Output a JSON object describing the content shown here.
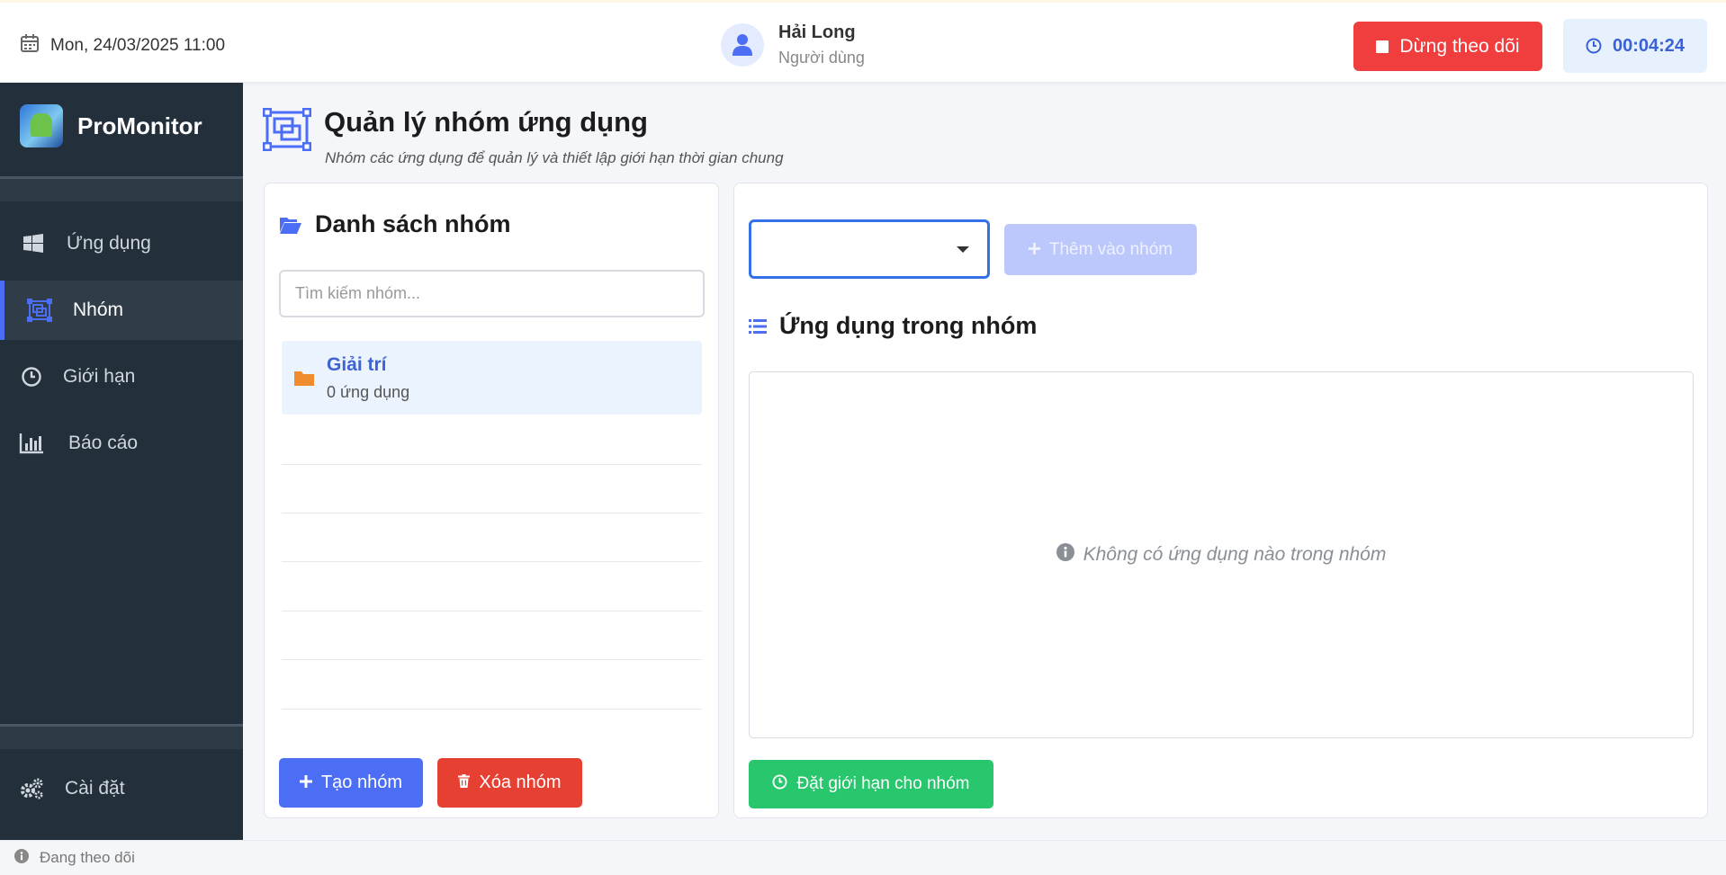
{
  "header": {
    "datetime": "Mon, 24/03/2025 11:00",
    "user_name": "Hải Long",
    "user_role": "Người dùng",
    "stop_label": "Dừng theo dõi",
    "timer": "00:04:24"
  },
  "sidebar": {
    "brand": "ProMonitor",
    "items": [
      {
        "label": "Ứng dụng",
        "icon": "windows-icon"
      },
      {
        "label": "Nhóm",
        "icon": "object-group-icon",
        "active": true
      },
      {
        "label": "Giới hạn",
        "icon": "clock-icon"
      },
      {
        "label": "Báo cáo",
        "icon": "bar-chart-icon"
      }
    ],
    "settings_label": "Cài đặt"
  },
  "page": {
    "title": "Quản lý nhóm ứng dụng",
    "subtitle": "Nhóm các ứng dụng để quản lý và thiết lập giới hạn thời gian chung"
  },
  "group_list": {
    "title": "Danh sách nhóm",
    "search_placeholder": "Tìm kiếm nhóm...",
    "groups": [
      {
        "name": "Giải trí",
        "count": "0 ứng dụng"
      }
    ],
    "create_label": "Tạo nhóm",
    "delete_label": "Xóa nhóm"
  },
  "group_detail": {
    "app_select_value": "",
    "add_label": "Thêm vào nhóm",
    "apps_title": "Ứng dụng trong nhóm",
    "empty_message": "Không có ứng dụng nào trong nhóm",
    "set_limit_label": "Đặt giới hạn cho nhóm"
  },
  "status": {
    "text": "Đang theo dõi"
  },
  "colors": {
    "primary": "#4c6ef5",
    "danger": "#e64032",
    "success": "#28c66d",
    "sidebar_bg": "#232f3a"
  }
}
